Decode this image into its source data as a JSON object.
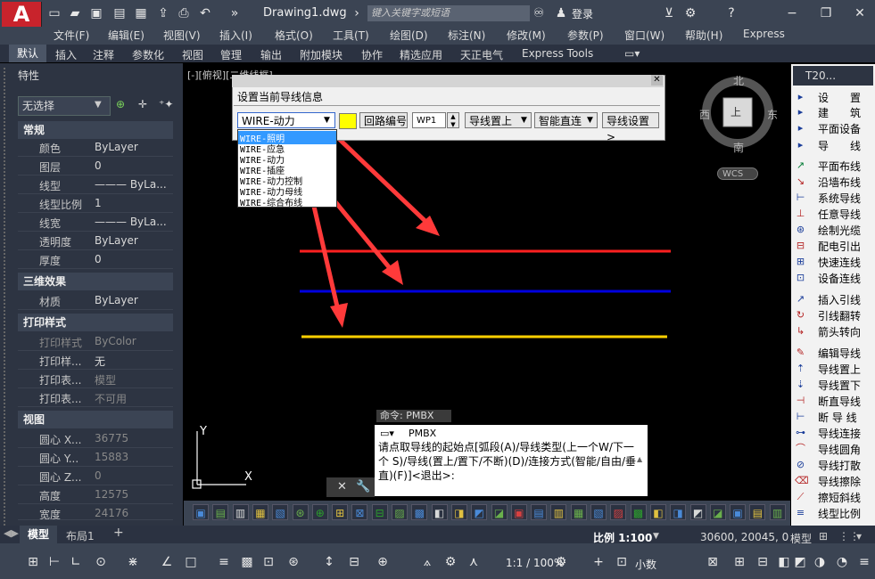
{
  "titlebar": {
    "document_title": "Drawing1.dwg",
    "search_placeholder": "键入关键字或短语",
    "login_label": "登录"
  },
  "menu": [
    "文件(F)",
    "编辑(E)",
    "视图(V)",
    "插入(I)",
    "格式(O)",
    "工具(T)",
    "绘图(D)",
    "标注(N)",
    "修改(M)",
    "参数(P)",
    "窗口(W)",
    "帮助(H)",
    "Express"
  ],
  "ribbon_tabs": [
    "默认",
    "插入",
    "注释",
    "参数化",
    "视图",
    "管理",
    "输出",
    "附加模块",
    "协作",
    "精选应用",
    "天正电气",
    "Express Tools"
  ],
  "properties": {
    "title": "特性",
    "selection": "无选择",
    "sections": [
      {
        "name": "常规",
        "rows": [
          [
            "颜色",
            "ByLayer"
          ],
          [
            "图层",
            "0"
          ],
          [
            "线型",
            "——— ByLa..."
          ],
          [
            "线型比例",
            "1"
          ],
          [
            "线宽",
            "——— ByLa..."
          ],
          [
            "透明度",
            "ByLayer"
          ],
          [
            "厚度",
            "0"
          ]
        ]
      },
      {
        "name": "三维效果",
        "rows": [
          [
            "材质",
            "ByLayer"
          ]
        ]
      },
      {
        "name": "打印样式",
        "rows": [
          [
            "打印样式",
            "ByColor"
          ],
          [
            "打印样...",
            "无"
          ],
          [
            "打印表...",
            "模型"
          ],
          [
            "打印表...",
            "不可用"
          ]
        ]
      },
      {
        "name": "视图",
        "rows": [
          [
            "圆心 X...",
            "36775"
          ],
          [
            "圆心 Y...",
            "15883"
          ],
          [
            "圆心 Z...",
            "0"
          ],
          [
            "高度",
            "12575"
          ],
          [
            "宽度",
            "24176"
          ]
        ]
      }
    ]
  },
  "viewport_label": "[-][俯视][二维线框]",
  "dialog": {
    "title": "设置当前导线信息",
    "wire_type": "WIRE-动力",
    "circuit_button": "回路编号",
    "circuit_value": "WP1",
    "wire_position": "导线置上",
    "connect_mode": "智能直连",
    "settings_button": "导线设置>",
    "options": [
      "WIRE-照明",
      "WIRE-应急",
      "WIRE-动力",
      "WIRE-插座",
      "WIRE-动力控制",
      "WIRE-动力母线",
      "WIRE-综合布线"
    ]
  },
  "viewcube": {
    "north": "北",
    "south": "南",
    "east": "东",
    "west": "西",
    "top": "上",
    "wcs": "WCS"
  },
  "right_toolbar": {
    "title": "T20...",
    "items": [
      "设　　置",
      "建　　筑",
      "平面设备",
      "导　　线",
      "平面布线",
      "沿墙布线",
      "系统导线",
      "任意导线",
      "绘制光缆",
      "配电引出",
      "快速连线",
      "设备连线",
      "插入引线",
      "引线翻转",
      "箭头转向",
      "编辑导线",
      "导线置上",
      "导线置下",
      "断直导线",
      "断 导 线",
      "导线连接",
      "导线圆角",
      "导线打散",
      "导线擦除",
      "擦短斜线",
      "线型比例"
    ]
  },
  "command": {
    "label": "命令: PMBX",
    "name": "PMBX",
    "prompt": "请点取导线的起始点[弧段(A)/导线类型(上一个W/下一个 S)/导线(置上/置下/不断)(D)/连接方式(智能/自由/垂直)(F)]<退出>:"
  },
  "layout_tabs": [
    "模型",
    "布局1"
  ],
  "status": {
    "scale": "比例 1:100",
    "coords": "30600, 20045, 0",
    "mode": "模型",
    "zoom": "1:1 / 100%",
    "units": "小数"
  },
  "colors": {
    "wire_red": "#ff2020",
    "wire_blue": "#0000e0",
    "wire_yellow": "#ffd000",
    "arrow": "#ff3030"
  }
}
